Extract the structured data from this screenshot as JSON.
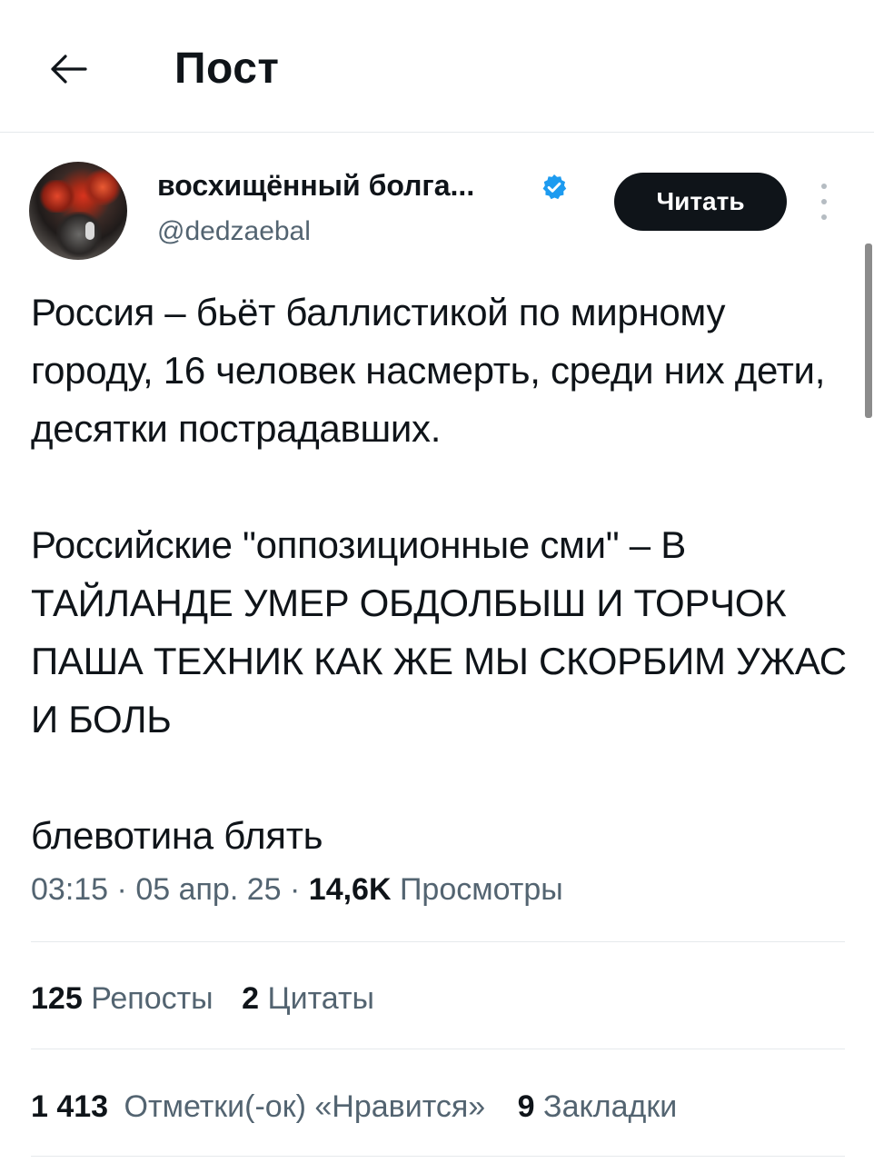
{
  "header": {
    "title": "Пост"
  },
  "author": {
    "display_name": "восхищённый болга...",
    "handle": "@dedzaebal",
    "follow_label": "Читать"
  },
  "tweet": {
    "paragraphs": [
      "Россия – бьёт баллистикой по мирному городу, 16 человек насмерть, среди них дети, десятки пострадавших.",
      "Российские \"оппозиционные сми\" – В ТАЙЛАНДЕ УМЕР ОБДОЛБЫШ И ТОРЧОК ПАША ТЕХНИК КАК ЖЕ МЫ СКОРБИМ УЖАС И БОЛЬ",
      "блевотина блять"
    ]
  },
  "meta": {
    "time": "03:15",
    "date": "05 апр. 25",
    "views_count": "14,6K",
    "views_label": "Просмотры",
    "separator": "·"
  },
  "stats": {
    "reposts_count": "125",
    "reposts_label": "Репосты",
    "quotes_count": "2",
    "quotes_label": "Цитаты",
    "likes_count": "1 413",
    "likes_label": "Отметки(-ок) «Нравится»",
    "bookmarks_count": "9",
    "bookmarks_label": "Закладки"
  },
  "colors": {
    "text": "#0f1419",
    "secondary": "#536471",
    "verified": "#1d9bf0",
    "divider": "#e6e9ec"
  },
  "icons": {
    "back": "arrow-left-icon",
    "verified": "verified-badge-icon",
    "more": "more-vertical-icon"
  }
}
